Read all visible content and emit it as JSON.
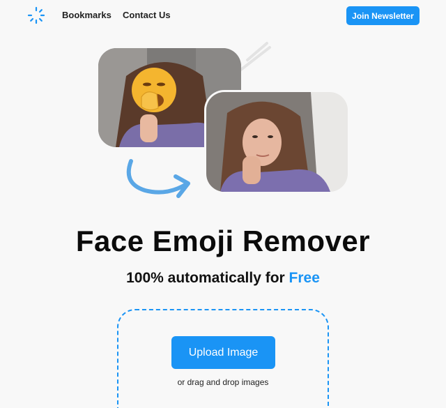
{
  "nav": {
    "logo_icon": "spinner-logo-icon",
    "links": [
      "Bookmarks",
      "Contact Us"
    ],
    "newsletter_label": "Join Newsletter"
  },
  "hero": {
    "before_image": "girl-photo-with-yawning-emoji",
    "after_image": "girl-photo-without-emoji",
    "arrow_icon": "curved-arrow-icon"
  },
  "main": {
    "title": "Face Emoji Remover",
    "subtitle_prefix": "100% automatically for ",
    "subtitle_accent": "Free"
  },
  "upload": {
    "button_label": "Upload Image",
    "drag_text": "or drag and drop images"
  },
  "colors": {
    "accent": "#1a94f5",
    "background": "#f8f8f8"
  }
}
